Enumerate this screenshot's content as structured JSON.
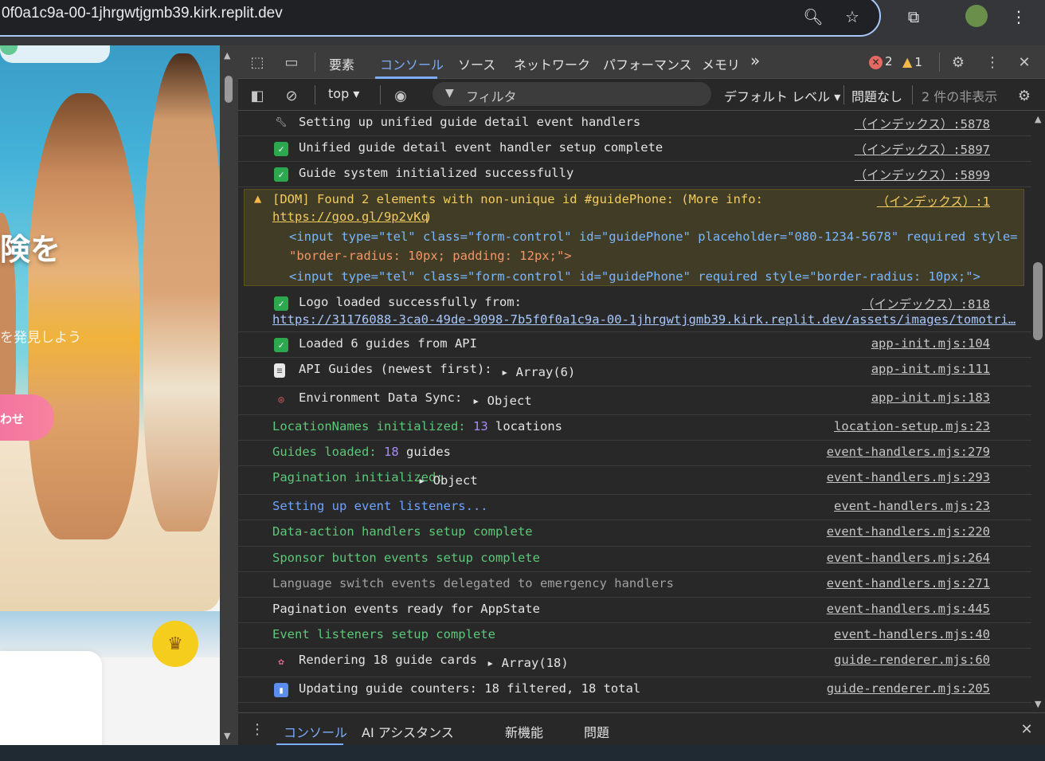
{
  "address_bar": {
    "url": "0f0a1c9a-00-1jhrgwtjgmb39.kirk.replit.dev",
    "icons": [
      "zoom-icon",
      "bookmark-star-icon",
      "extensions-icon",
      "profile-avatar",
      "menu-icon"
    ]
  },
  "page_preview": {
    "hero_text": "険を",
    "hero_sub": "を発見しよう",
    "hero_button": "わせ"
  },
  "devtools": {
    "tabs": [
      "要素",
      "コンソール",
      "ソース",
      "ネットワーク",
      "パフォーマンス",
      "メモリ"
    ],
    "more_tabs": "»",
    "error_count": "2",
    "warning_count": "1",
    "context": "top",
    "filter_placeholder": "フィルタ",
    "levels": "デフォルト レベル",
    "issues": "問題なし",
    "hidden_count": "2 件の非表示",
    "drawer_tabs": [
      "コンソール",
      "AI アシスタンス",
      "新機能",
      "問題"
    ]
  },
  "console": {
    "rows": [
      {
        "icon": "wrench",
        "text": "Setting up unified guide detail event handlers",
        "src": "（インデックス）:5878"
      },
      {
        "icon": "check",
        "text": "Unified guide detail event handler setup complete",
        "src": "（インデックス）:5897"
      },
      {
        "icon": "check",
        "text": "Guide system initialized successfully",
        "src": "（インデックス）:5899"
      }
    ],
    "warning": {
      "line1": "[DOM] Found 2 elements with non-unique id #guidePhone: (More info:",
      "link": "https://goo.gl/9p2vKq",
      "close": ")",
      "src": "（インデックス）:1",
      "html1a": "<input type=\"tel\" class=\"form-control\" id=\"guidePhone\" placeholder=\"080-1234-5678\" required style=",
      "html1b": "\"border-radius: 10px; padding: 12px;\">",
      "html2": "<input type=\"tel\" class=\"form-control\" id=\"guidePhone\" required style=\"border-radius: 10px;\">"
    },
    "logo": {
      "text": "Logo loaded successfully from:",
      "url": "https://31176088-3ca0-49de-9098-7b5f0f0a1c9a-00-1jhrgwtjgmb39.kirk.replit.dev/assets/images/tomotri…",
      "src": "（インデックス）:818"
    },
    "rows2": [
      {
        "text": "Loaded 6 guides from API",
        "src": "app-init.mjs:104"
      },
      {
        "text": "API Guides (newest first):",
        "obj": "Array(6)",
        "src": "app-init.mjs:111"
      },
      {
        "text": "Environment Data Sync:",
        "obj": "Object",
        "src": "app-init.mjs:183"
      }
    ],
    "location": {
      "a": "LocationNames initialized:",
      "n": "13",
      "b": "locations",
      "src": "location-setup.mjs:23"
    },
    "guides": {
      "a": "Guides loaded:",
      "n": "18",
      "b": "guides",
      "src": "event-handlers.mjs:279"
    },
    "pagination": {
      "a": "Pagination initialized:",
      "obj": "Object",
      "src": "event-handlers.mjs:293"
    },
    "plain": [
      {
        "text": "Setting up event listeners...",
        "src": "event-handlers.mjs:23"
      },
      {
        "text": "Data-action handlers setup complete",
        "src": "event-handlers.mjs:220"
      },
      {
        "text": "Sponsor button events setup complete",
        "src": "event-handlers.mjs:264"
      },
      {
        "text": "Language switch events delegated to emergency handlers",
        "src": "event-handlers.mjs:271"
      },
      {
        "text": "Pagination events ready for AppState",
        "src": "event-handlers.mjs:445"
      },
      {
        "text": "Event listeners setup complete",
        "src": "event-handlers.mjs:40"
      }
    ],
    "render": {
      "text": "Rendering 18 guide cards",
      "obj": "Array(18)",
      "src": "guide-renderer.mjs:60"
    },
    "counters": {
      "text": "Updating guide counters: 18 filtered, 18 total",
      "src": "guide-renderer.mjs:205"
    }
  },
  "colors": {
    "accent": "#7cacf8",
    "log_green": "#5cc878",
    "log_blue": "#6ea3ff",
    "warning_bg": "#413c26"
  }
}
